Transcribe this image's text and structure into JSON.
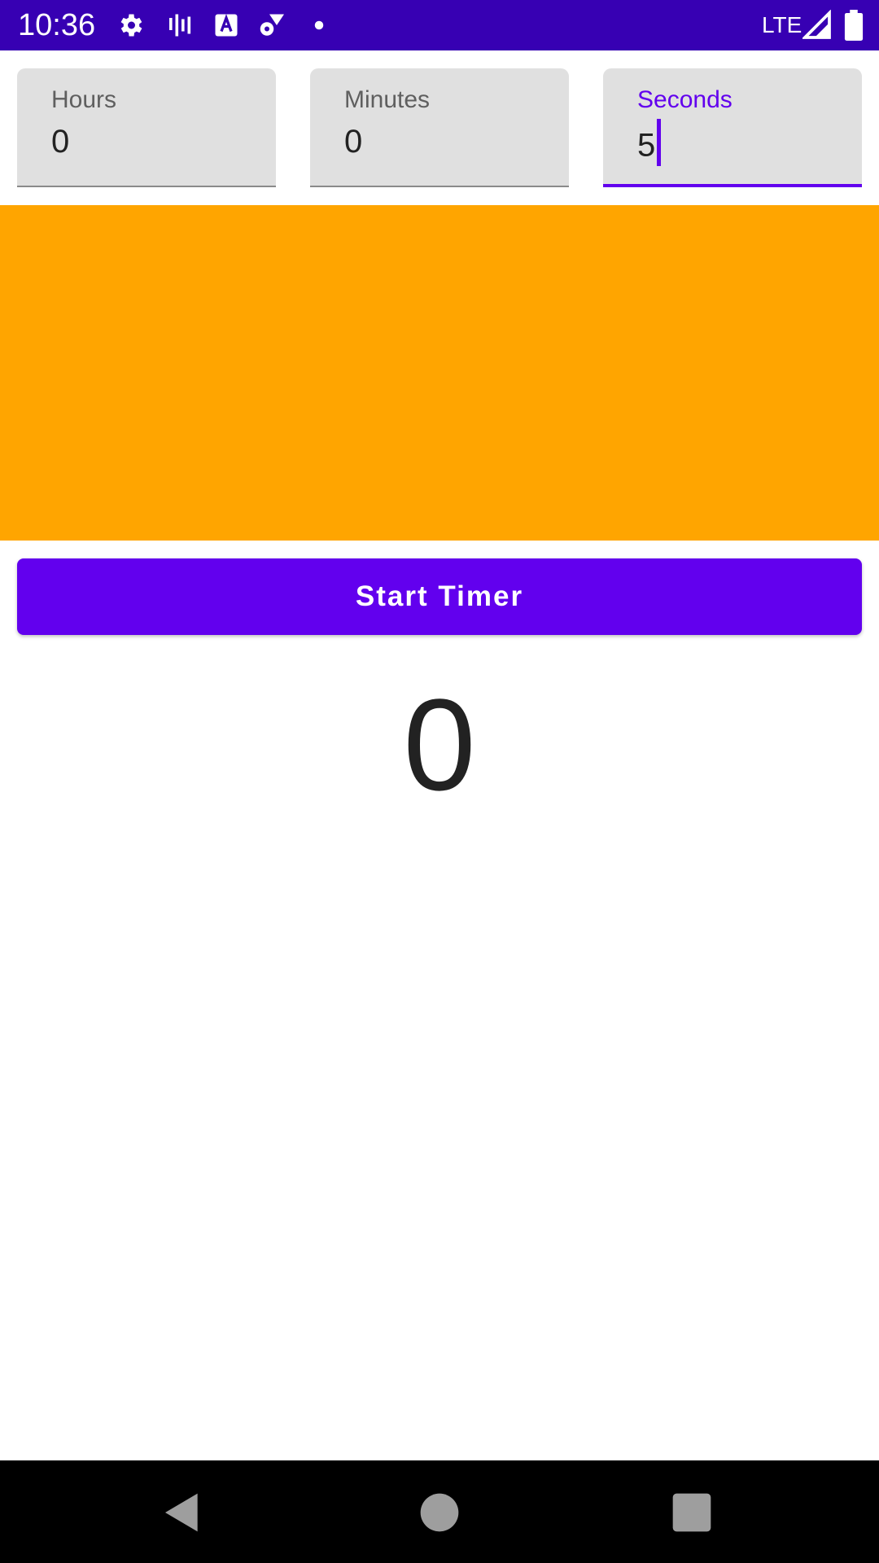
{
  "status_bar": {
    "time": "10:36",
    "network": "LTE",
    "icons": [
      "gear-icon",
      "activity-icon",
      "a-badge-icon",
      "gear-wifi-icon",
      "dot-icon",
      "signal-icon",
      "battery-icon"
    ]
  },
  "fields": {
    "hours": {
      "label": "Hours",
      "value": "0"
    },
    "minutes": {
      "label": "Minutes",
      "value": "0"
    },
    "seconds": {
      "label": "Seconds",
      "value": "5"
    }
  },
  "start_button": {
    "label": "Start Timer"
  },
  "countdown": {
    "value": "0"
  },
  "colors": {
    "status_bar": "#3700b3",
    "accent": "#6200ee",
    "panel": "#ffa500",
    "field_bg": "#e0e0e0"
  },
  "nav": {
    "icons": [
      "back-icon",
      "home-icon",
      "recents-icon"
    ]
  }
}
